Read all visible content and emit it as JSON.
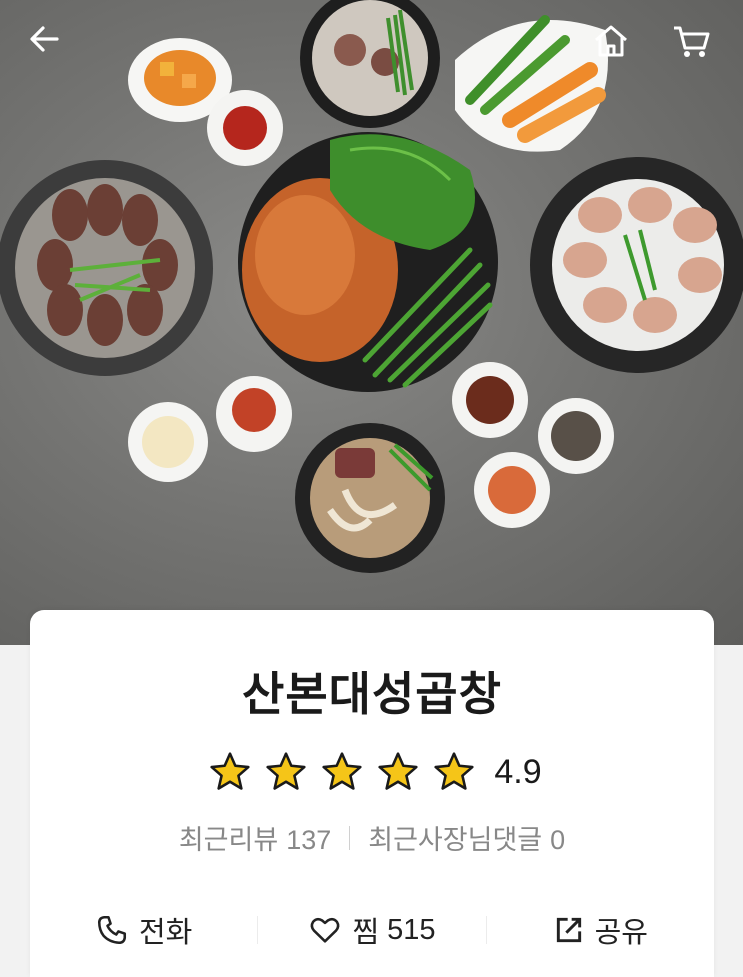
{
  "nav": {
    "back_icon": "arrow-left-icon",
    "home_icon": "home-icon",
    "cart_icon": "cart-icon"
  },
  "store": {
    "name": "산본대성곱창",
    "rating": "4.9",
    "rating_stars": 5,
    "rating_max": 5,
    "recent_reviews_label": "최근리뷰",
    "recent_reviews_count": "137",
    "owner_replies_label": "최근사장님댓글",
    "owner_replies_count": "0"
  },
  "actions": {
    "call_label": "전화",
    "favorite_label": "찜",
    "favorite_count": "515",
    "share_label": "공유"
  },
  "colors": {
    "star": "#f5c518",
    "text_primary": "#1a1a1a",
    "text_secondary": "#888888",
    "card_bg": "#ffffff",
    "page_bg": "#f2f2f2"
  }
}
